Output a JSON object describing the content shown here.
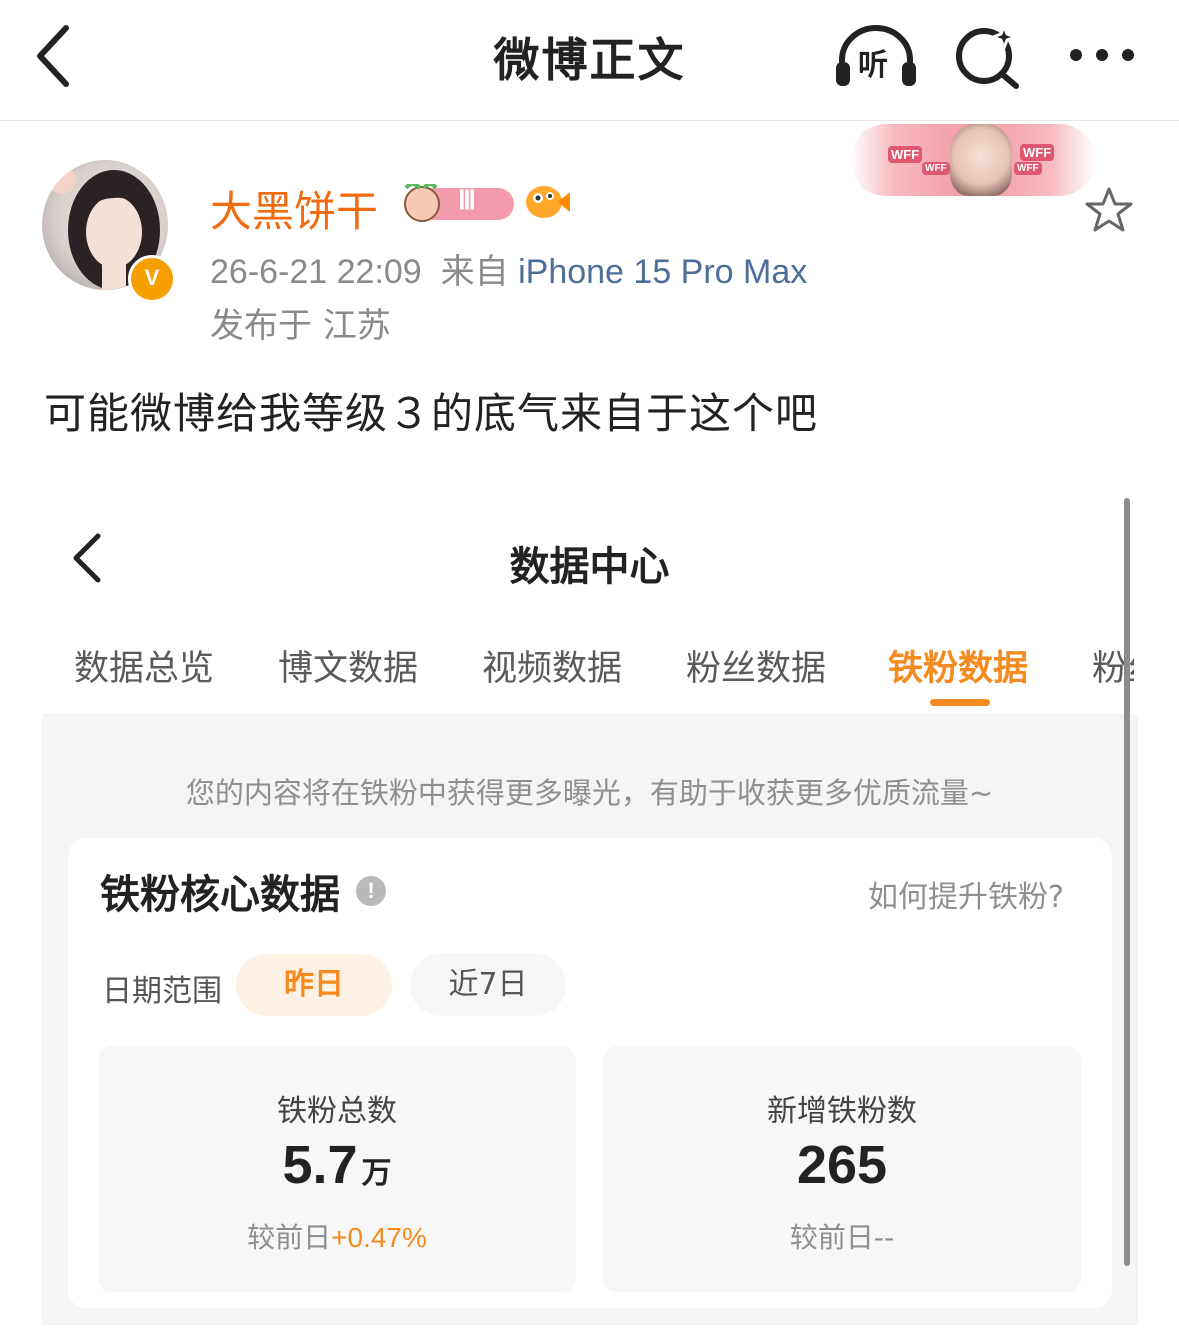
{
  "nav": {
    "title": "微博正文",
    "listen_label": "听",
    "back_icon": "chevron-left-icon",
    "search_icon": "search-sparkle-icon",
    "more_icon": "more-horizontal-icon"
  },
  "post": {
    "author": "大黑饼干",
    "level_badge": "Ⅲ",
    "verified_badge": "V",
    "time": "26-6-21 22:09",
    "source_prefix": "来自",
    "device": "iPhone 15 Pro Max",
    "location": "发布于 江苏",
    "text": "可能微博给我等级３的底气来自于这个吧",
    "fan_banner_tags": [
      "WFF",
      "WFF",
      "WFF",
      "WFF"
    ]
  },
  "screenshot": {
    "title": "数据中心",
    "tabs": [
      {
        "label": "数据总览"
      },
      {
        "label": "博文数据"
      },
      {
        "label": "视频数据"
      },
      {
        "label": "粉丝数据"
      },
      {
        "label": "铁粉数据"
      },
      {
        "label": "粉丝"
      }
    ],
    "active_tab": "铁粉数据",
    "tip": "您的内容将在铁粉中获得更多曝光，有助于收获更多优质流量~",
    "card": {
      "title": "铁粉核心数据",
      "info_icon": "!",
      "how_link": "如何提升铁粉?",
      "date_label": "日期范围",
      "date_options": [
        "昨日",
        "近7日"
      ],
      "selected_date": "昨日",
      "stats": [
        {
          "label": "铁粉总数",
          "value": "5.7",
          "unit": "万",
          "compare_prefix": "较前日",
          "compare_value": "+0.47%"
        },
        {
          "label": "新增铁粉数",
          "value": "265",
          "unit": "",
          "compare_prefix": "较前日",
          "compare_value": "--"
        }
      ]
    }
  },
  "colors": {
    "accent": "#f58a1f",
    "author_name": "#f26b0f",
    "device_link": "#4e6e9a"
  }
}
